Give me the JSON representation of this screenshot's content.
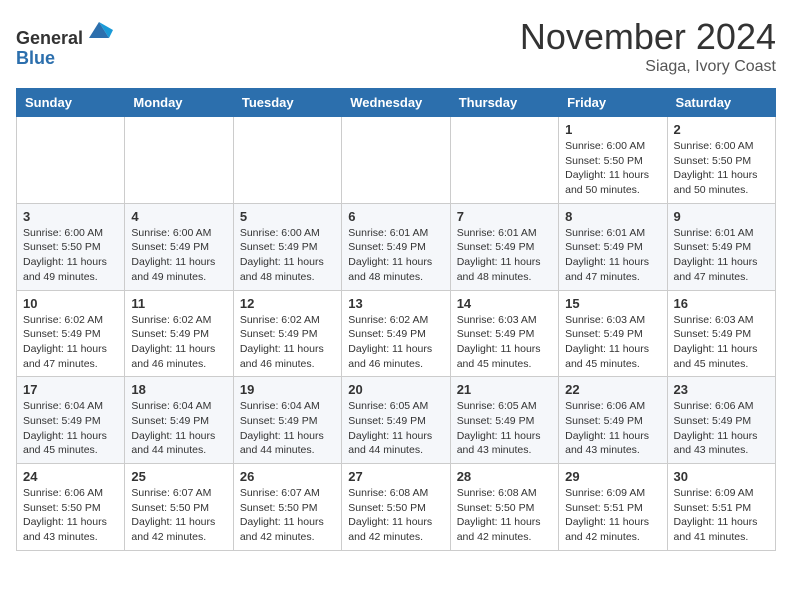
{
  "header": {
    "logo_line1": "General",
    "logo_line2": "Blue",
    "month_title": "November 2024",
    "location": "Siaga, Ivory Coast"
  },
  "weekdays": [
    "Sunday",
    "Monday",
    "Tuesday",
    "Wednesday",
    "Thursday",
    "Friday",
    "Saturday"
  ],
  "weeks": [
    [
      {
        "day": "",
        "info": ""
      },
      {
        "day": "",
        "info": ""
      },
      {
        "day": "",
        "info": ""
      },
      {
        "day": "",
        "info": ""
      },
      {
        "day": "",
        "info": ""
      },
      {
        "day": "1",
        "info": "Sunrise: 6:00 AM\nSunset: 5:50 PM\nDaylight: 11 hours\nand 50 minutes."
      },
      {
        "day": "2",
        "info": "Sunrise: 6:00 AM\nSunset: 5:50 PM\nDaylight: 11 hours\nand 50 minutes."
      }
    ],
    [
      {
        "day": "3",
        "info": "Sunrise: 6:00 AM\nSunset: 5:50 PM\nDaylight: 11 hours\nand 49 minutes."
      },
      {
        "day": "4",
        "info": "Sunrise: 6:00 AM\nSunset: 5:49 PM\nDaylight: 11 hours\nand 49 minutes."
      },
      {
        "day": "5",
        "info": "Sunrise: 6:00 AM\nSunset: 5:49 PM\nDaylight: 11 hours\nand 48 minutes."
      },
      {
        "day": "6",
        "info": "Sunrise: 6:01 AM\nSunset: 5:49 PM\nDaylight: 11 hours\nand 48 minutes."
      },
      {
        "day": "7",
        "info": "Sunrise: 6:01 AM\nSunset: 5:49 PM\nDaylight: 11 hours\nand 48 minutes."
      },
      {
        "day": "8",
        "info": "Sunrise: 6:01 AM\nSunset: 5:49 PM\nDaylight: 11 hours\nand 47 minutes."
      },
      {
        "day": "9",
        "info": "Sunrise: 6:01 AM\nSunset: 5:49 PM\nDaylight: 11 hours\nand 47 minutes."
      }
    ],
    [
      {
        "day": "10",
        "info": "Sunrise: 6:02 AM\nSunset: 5:49 PM\nDaylight: 11 hours\nand 47 minutes."
      },
      {
        "day": "11",
        "info": "Sunrise: 6:02 AM\nSunset: 5:49 PM\nDaylight: 11 hours\nand 46 minutes."
      },
      {
        "day": "12",
        "info": "Sunrise: 6:02 AM\nSunset: 5:49 PM\nDaylight: 11 hours\nand 46 minutes."
      },
      {
        "day": "13",
        "info": "Sunrise: 6:02 AM\nSunset: 5:49 PM\nDaylight: 11 hours\nand 46 minutes."
      },
      {
        "day": "14",
        "info": "Sunrise: 6:03 AM\nSunset: 5:49 PM\nDaylight: 11 hours\nand 45 minutes."
      },
      {
        "day": "15",
        "info": "Sunrise: 6:03 AM\nSunset: 5:49 PM\nDaylight: 11 hours\nand 45 minutes."
      },
      {
        "day": "16",
        "info": "Sunrise: 6:03 AM\nSunset: 5:49 PM\nDaylight: 11 hours\nand 45 minutes."
      }
    ],
    [
      {
        "day": "17",
        "info": "Sunrise: 6:04 AM\nSunset: 5:49 PM\nDaylight: 11 hours\nand 45 minutes."
      },
      {
        "day": "18",
        "info": "Sunrise: 6:04 AM\nSunset: 5:49 PM\nDaylight: 11 hours\nand 44 minutes."
      },
      {
        "day": "19",
        "info": "Sunrise: 6:04 AM\nSunset: 5:49 PM\nDaylight: 11 hours\nand 44 minutes."
      },
      {
        "day": "20",
        "info": "Sunrise: 6:05 AM\nSunset: 5:49 PM\nDaylight: 11 hours\nand 44 minutes."
      },
      {
        "day": "21",
        "info": "Sunrise: 6:05 AM\nSunset: 5:49 PM\nDaylight: 11 hours\nand 43 minutes."
      },
      {
        "day": "22",
        "info": "Sunrise: 6:06 AM\nSunset: 5:49 PM\nDaylight: 11 hours\nand 43 minutes."
      },
      {
        "day": "23",
        "info": "Sunrise: 6:06 AM\nSunset: 5:49 PM\nDaylight: 11 hours\nand 43 minutes."
      }
    ],
    [
      {
        "day": "24",
        "info": "Sunrise: 6:06 AM\nSunset: 5:50 PM\nDaylight: 11 hours\nand 43 minutes."
      },
      {
        "day": "25",
        "info": "Sunrise: 6:07 AM\nSunset: 5:50 PM\nDaylight: 11 hours\nand 42 minutes."
      },
      {
        "day": "26",
        "info": "Sunrise: 6:07 AM\nSunset: 5:50 PM\nDaylight: 11 hours\nand 42 minutes."
      },
      {
        "day": "27",
        "info": "Sunrise: 6:08 AM\nSunset: 5:50 PM\nDaylight: 11 hours\nand 42 minutes."
      },
      {
        "day": "28",
        "info": "Sunrise: 6:08 AM\nSunset: 5:50 PM\nDaylight: 11 hours\nand 42 minutes."
      },
      {
        "day": "29",
        "info": "Sunrise: 6:09 AM\nSunset: 5:51 PM\nDaylight: 11 hours\nand 42 minutes."
      },
      {
        "day": "30",
        "info": "Sunrise: 6:09 AM\nSunset: 5:51 PM\nDaylight: 11 hours\nand 41 minutes."
      }
    ]
  ]
}
